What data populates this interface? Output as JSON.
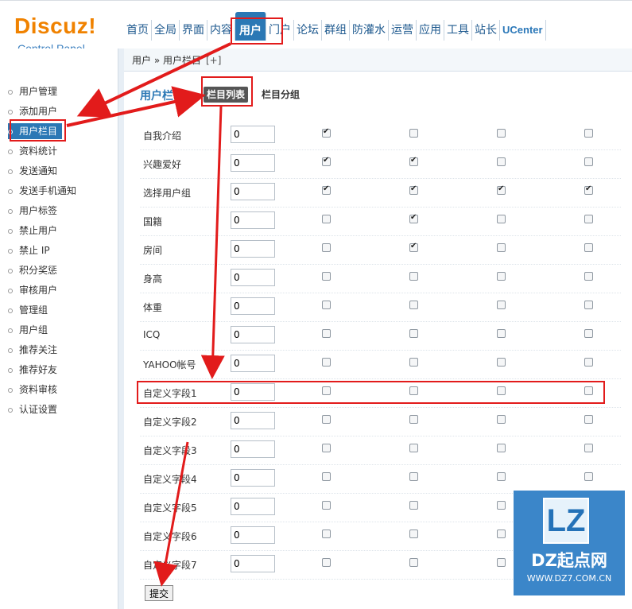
{
  "logo": {
    "main": "Discuz!",
    "sub": "Control Panel"
  },
  "nav": [
    "首页",
    "全局",
    "界面",
    "内容",
    "用户",
    "门户",
    "论坛",
    "群组",
    "防灌水",
    "运营",
    "应用",
    "工具",
    "站长",
    "UCenter"
  ],
  "nav_active": "用户",
  "breadcrumb": {
    "text": "用户 » 用户栏目",
    "add": "[+]"
  },
  "sidebar": [
    "用户管理",
    "添加用户",
    "用户栏目",
    "资料统计",
    "发送通知",
    "发送手机通知",
    "用户标签",
    "禁止用户",
    "禁止 IP",
    "积分奖惩",
    "审核用户",
    "管理组",
    "用户组",
    "推荐关注",
    "推荐好友",
    "资料审核",
    "认证设置"
  ],
  "sidebar_active": "用户栏目",
  "section": {
    "title": "用户栏目",
    "tab_current": "栏目列表",
    "tab_other": "栏目分组"
  },
  "fields": [
    {
      "label": "自我介绍",
      "order": "0",
      "checks": [
        true,
        false,
        false,
        false
      ]
    },
    {
      "label": "兴趣爱好",
      "order": "0",
      "checks": [
        true,
        true,
        false,
        false
      ]
    },
    {
      "label": "选择用户组",
      "order": "0",
      "checks": [
        true,
        true,
        true,
        true
      ]
    },
    {
      "label": "国籍",
      "order": "0",
      "checks": [
        false,
        true,
        false,
        false
      ]
    },
    {
      "label": "房间",
      "order": "0",
      "checks": [
        false,
        true,
        false,
        false
      ]
    },
    {
      "label": "身高",
      "order": "0",
      "checks": [
        false,
        false,
        false,
        false
      ]
    },
    {
      "label": "体重",
      "order": "0",
      "checks": [
        false,
        false,
        false,
        false
      ]
    },
    {
      "label": "ICQ",
      "order": "0",
      "checks": [
        false,
        false,
        false,
        false
      ]
    },
    {
      "label": "YAHOO帐号",
      "order": "0",
      "checks": [
        false,
        false,
        false,
        false
      ]
    },
    {
      "label": "自定义字段1",
      "order": "0",
      "checks": [
        false,
        false,
        false,
        false
      ]
    },
    {
      "label": "自定义字段2",
      "order": "0",
      "checks": [
        false,
        false,
        false,
        false
      ]
    },
    {
      "label": "自定义字段3",
      "order": "0",
      "checks": [
        false,
        false,
        false,
        false
      ]
    },
    {
      "label": "自定义字段4",
      "order": "0",
      "checks": [
        false,
        false,
        false,
        false
      ]
    },
    {
      "label": "自定义字段5",
      "order": "0",
      "checks": [
        false,
        false,
        false,
        false
      ]
    },
    {
      "label": "自定义字段6",
      "order": "0",
      "checks": [
        false,
        false,
        false,
        false
      ]
    },
    {
      "label": "自定义字段7",
      "order": "0",
      "checks": [
        false,
        false,
        false,
        false
      ]
    }
  ],
  "submit_label": "提交",
  "watermark": {
    "badge": "LZ",
    "name": "DZ起点网",
    "url": "WWW.DZ7.COM.CN"
  },
  "colors": {
    "accent": "#2b78b5",
    "logo": "#f08200",
    "annotation": "#e21b1b"
  }
}
